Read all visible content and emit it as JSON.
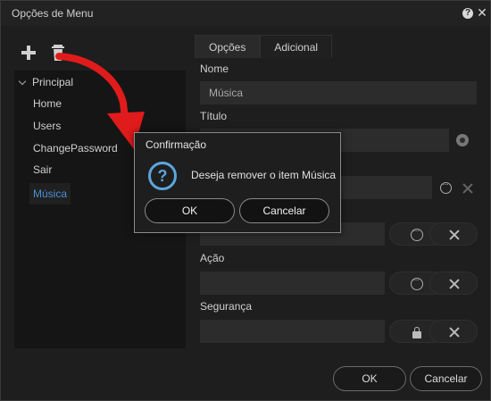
{
  "window": {
    "title": "Opções de Menu",
    "help_icon": "help-icon",
    "close_icon": "close-icon"
  },
  "toolbar": {
    "add_icon": "plus-icon",
    "delete_icon": "trash-icon"
  },
  "tree": {
    "root": "Principal",
    "items": [
      "Home",
      "Users",
      "ChangePassword",
      "Sair",
      "Música"
    ],
    "selected_index": 4
  },
  "tabs": [
    {
      "label": "Opções",
      "active": true
    },
    {
      "label": "Adicional",
      "active": false
    }
  ],
  "form": {
    "nome_label": "Nome",
    "nome_value": "Música",
    "titulo_label": "Título",
    "titulo_value": "",
    "acao_label": "Ação",
    "acao_value": "",
    "seguranca_label": "Segurança",
    "seguranca_value": ""
  },
  "footer": {
    "ok_label": "OK",
    "cancel_label": "Cancelar"
  },
  "dialog": {
    "title": "Confirmação",
    "message": "Deseja remover o item Música",
    "icon": "question-icon",
    "ok_label": "OK",
    "cancel_label": "Cancelar"
  },
  "colors": {
    "accent": "#5ba6de",
    "selected_text": "#4a8fd6",
    "arrow": "#e01b1b",
    "background": "#1e1e1e"
  }
}
